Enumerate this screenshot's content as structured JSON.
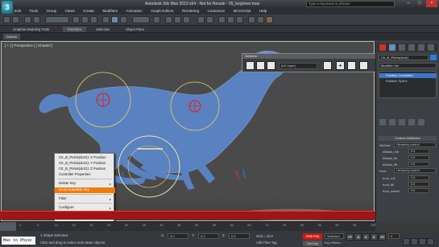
{
  "app": {
    "title": "Autodesk 3ds Max 2013 x64 - Not for Resale - 05_beginner.max",
    "search_placeholder": "Type a keyword or phrase"
  },
  "menubar": [
    "Edit",
    "Tools",
    "Group",
    "Views",
    "Create",
    "Modifiers",
    "Animation",
    "Graph Editors",
    "Rendering",
    "Customize",
    "MAXScript",
    "Help"
  ],
  "ribbon": {
    "tabs": [
      "Graphite Modeling Tools",
      "Freeform",
      "Selection",
      "Object Paint"
    ],
    "default_label": "Default"
  },
  "viewport": {
    "label": "[ + ] [ Perspective ] [ Shaded ]"
  },
  "schematic": {
    "title": "Schema",
    "field": "[All Layer]"
  },
  "context_menu": {
    "items": [
      {
        "label": "Ctr_B_Pelvis(slot1): X Position",
        "hl": false
      },
      {
        "label": "Ctr_B_Pelvis(slot1): Y Position",
        "hl": false
      },
      {
        "label": "Ctr_B_Pelvis(slot1): Z Position",
        "hl": false
      },
      {
        "label": "Controller Properties",
        "hl": false
      },
      {
        "label": "Delete Key",
        "hl": false
      },
      {
        "label": "Go to  Autodesk Key",
        "hl": true
      },
      {
        "label": "Filter",
        "hl": false
      },
      {
        "label": "Configure",
        "hl": false
      },
      {
        "label": "Go to Time",
        "hl": false
      }
    ]
  },
  "command_panel": {
    "object_name": "Ctr_B_Pelvis(slot1)",
    "modifier_list": "Modifier List",
    "stack": [
      "Position Constraint",
      "Editable Spline"
    ],
    "section": "Custom Attributes",
    "method_label": "Method",
    "method_value": "Hierarchy control",
    "params": [
      {
        "label": "hiBack_roll",
        "value": "0.0"
      },
      {
        "label": "hiBack_tilt",
        "value": "0.0"
      },
      {
        "label": "hiBack_lift",
        "value": "0.0"
      },
      {
        "label": "Root",
        "value": "Hierarchy control"
      },
      {
        "label": "hoof_roll",
        "value": "0.0"
      },
      {
        "label": "hoof_tilt",
        "value": "0.0"
      },
      {
        "label": "hoof_swivel",
        "value": "0.0"
      }
    ]
  },
  "timeline": {
    "ticks": [
      "0",
      "5",
      "10",
      "15",
      "20",
      "25",
      "30",
      "35",
      "40",
      "45",
      "50",
      "55",
      "60",
      "65",
      "70",
      "75",
      "80",
      "85",
      "90",
      "95",
      "100"
    ]
  },
  "status": {
    "macro": "Max to Physc",
    "line1": "1 Shape Selected",
    "line2": "Click and drag to select and rotate objects",
    "x": "0.0",
    "y": "0.0",
    "z": "0.0",
    "grid": "Grid = 10.0",
    "add_time_tag": "Add Time Tag",
    "auto_key": "Auto Key",
    "set_key": "Set Key",
    "selected": "Selected",
    "key_filters": "Key Filters...",
    "frame": "0"
  },
  "colors": {
    "horse": "#5a82c0",
    "accent": "#f07a0c",
    "autokey": "#c81919",
    "timeline_band": "#a01515"
  }
}
